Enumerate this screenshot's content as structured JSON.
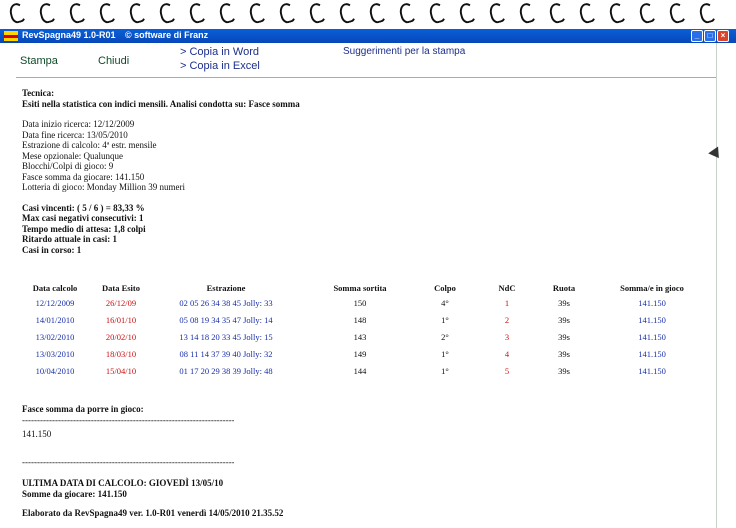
{
  "window": {
    "title": "RevSpagna49 1.0-R01",
    "subtitle": "© software di Franz",
    "buttons": [
      "_",
      "□",
      "×"
    ]
  },
  "menu": {
    "print": "Stampa",
    "close": "Chiudi",
    "copy_word": "> Copia in Word",
    "copy_excel": "> Copia in Excel",
    "print_tips": "Suggerimenti per la stampa"
  },
  "report": {
    "tecnica_label": "Tecnica:",
    "tecnica_desc": "Esiti nella statistica con indici mensili. Analisi condotta su: Fasce somma",
    "info": [
      "Data inizio ricerca: 12/12/2009",
      "Data fine ricerca: 13/05/2010",
      "Estrazione di calcolo: 4ª estr. mensile",
      "Mese opzionale: Qualunque",
      "Blocchi/Colpi di gioco: 9",
      "Fasce somma da giocare: 141.150",
      "Lotteria di gioco: Monday Million 39 numeri"
    ],
    "stats": [
      "Casi vincenti: ( 5 / 6 ) = 83,33 %",
      "Max casi negativi consecutivi: 1",
      "Tempo medio di attesa: 1,8 colpi",
      "Ritardo attuale in casi: 1",
      "Casi in corso: 1"
    ],
    "table": {
      "headers": [
        "Data calcolo",
        "Data Esito",
        "Estrazione",
        "Somma sortita",
        "Colpo",
        "NdC",
        "Ruota",
        "Somma/e in gioco"
      ],
      "rows": [
        [
          "12/12/2009",
          "26/12/09",
          "02 05 26 34 38 45 Jolly: 33",
          "150",
          "4°",
          "1",
          "39s",
          "141.150"
        ],
        [
          "14/01/2010",
          "16/01/10",
          "05 08 19 34 35 47 Jolly: 14",
          "148",
          "1°",
          "2",
          "39s",
          "141.150"
        ],
        [
          "13/02/2010",
          "20/02/10",
          "13 14 18 20 33 45 Jolly: 15",
          "143",
          "2°",
          "3",
          "39s",
          "141.150"
        ],
        [
          "13/03/2010",
          "18/03/10",
          "08 11 14 37 39 40 Jolly: 32",
          "149",
          "1°",
          "4",
          "39s",
          "141.150"
        ],
        [
          "10/04/2010",
          "15/04/10",
          "01 17 20 29 38 39 Jolly: 48",
          "144",
          "1°",
          "5",
          "39s",
          "141.150"
        ]
      ]
    },
    "fasce_label": "Fasce somma da porre in gioco:",
    "dashes": "------------------------------------------------------------------------",
    "fasce_value": "141.150",
    "ultima_data": "ULTIMA DATA DI CALCOLO: GIOVEDÌ 13/05/10",
    "somme": "Somme da giocare: 141.150",
    "elaborato": "Elaborato da RevSpagna49 ver. 1.0-R01  venerdì 14/05/2010 21.35.52"
  }
}
